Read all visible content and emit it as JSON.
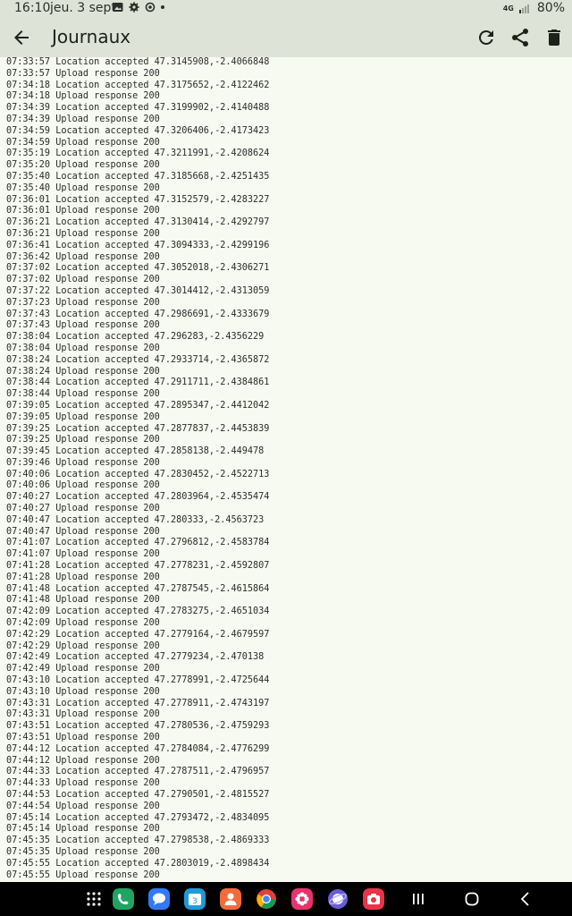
{
  "status_bar": {
    "time": "16:10",
    "date": "jeu. 3 sept.",
    "network": "4G",
    "battery": "80%"
  },
  "app_bar": {
    "title": "Journaux"
  },
  "log_lines": [
    "07:33:57 Location accepted 47.3145908,-2.4066848",
    "07:33:57 Upload response 200",
    "07:34:18 Location accepted 47.3175652,-2.4122462",
    "07:34:18 Upload response 200",
    "07:34:39 Location accepted 47.3199902,-2.4140488",
    "07:34:39 Upload response 200",
    "07:34:59 Location accepted 47.3206406,-2.4173423",
    "07:34:59 Upload response 200",
    "07:35:19 Location accepted 47.3211991,-2.4208624",
    "07:35:20 Upload response 200",
    "07:35:40 Location accepted 47.3185668,-2.4251435",
    "07:35:40 Upload response 200",
    "07:36:01 Location accepted 47.3152579,-2.4283227",
    "07:36:01 Upload response 200",
    "07:36:21 Location accepted 47.3130414,-2.4292797",
    "07:36:21 Upload response 200",
    "07:36:41 Location accepted 47.3094333,-2.4299196",
    "07:36:42 Upload response 200",
    "07:37:02 Location accepted 47.3052018,-2.4306271",
    "07:37:02 Upload response 200",
    "07:37:22 Location accepted 47.3014412,-2.4313059",
    "07:37:23 Upload response 200",
    "07:37:43 Location accepted 47.2986691,-2.4333679",
    "07:37:43 Upload response 200",
    "07:38:04 Location accepted 47.296283,-2.4356229",
    "07:38:04 Upload response 200",
    "07:38:24 Location accepted 47.2933714,-2.4365872",
    "07:38:24 Upload response 200",
    "07:38:44 Location accepted 47.2911711,-2.4384861",
    "07:38:44 Upload response 200",
    "07:39:05 Location accepted 47.2895347,-2.4412042",
    "07:39:05 Upload response 200",
    "07:39:25 Location accepted 47.2877837,-2.4453839",
    "07:39:25 Upload response 200",
    "07:39:45 Location accepted 47.2858138,-2.449478",
    "07:39:46 Upload response 200",
    "07:40:06 Location accepted 47.2830452,-2.4522713",
    "07:40:06 Upload response 200",
    "07:40:27 Location accepted 47.2803964,-2.4535474",
    "07:40:27 Upload response 200",
    "07:40:47 Location accepted 47.280333,-2.4563723",
    "07:40:47 Upload response 200",
    "07:41:07 Location accepted 47.2796812,-2.4583784",
    "07:41:07 Upload response 200",
    "07:41:28 Location accepted 47.2778231,-2.4592807",
    "07:41:28 Upload response 200",
    "07:41:48 Location accepted 47.2787545,-2.4615864",
    "07:41:48 Upload response 200",
    "07:42:09 Location accepted 47.2783275,-2.4651034",
    "07:42:09 Upload response 200",
    "07:42:29 Location accepted 47.2779164,-2.4679597",
    "07:42:29 Upload response 200",
    "07:42:49 Location accepted 47.2779234,-2.470138",
    "07:42:49 Upload response 200",
    "07:43:10 Location accepted 47.2778991,-2.4725644",
    "07:43:10 Upload response 200",
    "07:43:31 Location accepted 47.2778911,-2.4743197",
    "07:43:31 Upload response 200",
    "07:43:51 Location accepted 47.2780536,-2.4759293",
    "07:43:51 Upload response 200",
    "07:44:12 Location accepted 47.2784084,-2.4776299",
    "07:44:12 Upload response 200",
    "07:44:33 Location accepted 47.2787511,-2.4796957",
    "07:44:33 Upload response 200",
    "07:44:53 Location accepted 47.2790501,-2.4815527",
    "07:44:54 Upload response 200",
    "07:45:14 Location accepted 47.2793472,-2.4834095",
    "07:45:14 Upload response 200",
    "07:45:35 Location accepted 47.2798538,-2.4869333",
    "07:45:35 Upload response 200",
    "07:45:55 Location accepted 47.2803019,-2.4898434",
    "07:45:55 Upload response 200"
  ],
  "nav_bar": {
    "apps": [
      {
        "name": "app-drawer-icon",
        "color": "#000000"
      },
      {
        "name": "phone-app-icon",
        "color": "#1fa463"
      },
      {
        "name": "messages-app-icon",
        "color": "#2f7bf5"
      },
      {
        "name": "calendar-app-icon",
        "color": "#1e9bd6",
        "label": "3"
      },
      {
        "name": "contacts-app-icon",
        "color": "#f36b3b"
      },
      {
        "name": "chrome-app-icon",
        "color": "#ffffff"
      },
      {
        "name": "gallery-app-icon",
        "color": "#e8336d"
      },
      {
        "name": "internet-app-icon",
        "color": "#6a5bd6"
      },
      {
        "name": "camera-app-icon",
        "color": "#e8334a"
      }
    ]
  }
}
